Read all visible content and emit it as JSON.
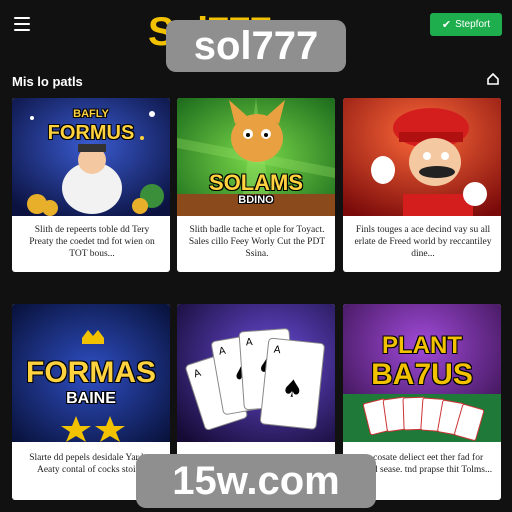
{
  "header": {
    "logo_text": "sol777",
    "logo_behind_text": "Sol777",
    "signup_label": "Stepfort",
    "signup_icon": "check-icon"
  },
  "section": {
    "title": "Mis lo patls",
    "icon": "home-icon"
  },
  "cards": [
    {
      "art_title": "FORMUS",
      "art_subtitle": "BAFLY",
      "desc": "Slith de repeerts toble dd Tery Preaty the coedet tnd fot wien on TOT bous..."
    },
    {
      "art_title": "SOLAMS",
      "art_subtitle": "BDINO",
      "desc": "Slith badle tache et ople for Toyact. Sales cillo Feey Worly Cut the PDT Ssina."
    },
    {
      "art_title": "",
      "art_subtitle": "",
      "desc": "Finls touges a ace decind vay su all erlate de Freed world by reccantiley dine..."
    },
    {
      "art_title": "FORMAS",
      "art_subtitle": "BAINE",
      "desc": "Slarte dd pepels desidale Yar hen Aeaty contal of cocks stoine."
    },
    {
      "art_title": "",
      "art_subtitle": "",
      "desc": ""
    },
    {
      "art_title": "BA7US",
      "art_subtitle": "PLANT",
      "desc": "se cosate deliect eet ther fad for creard sease. tnd prapse thit Tolms..."
    }
  ],
  "watermark": "15w.com",
  "colors": {
    "background": "#111111",
    "signup_green": "#1eae4e",
    "logo_yellow": "#f2c200",
    "overlay_gray": "#8f8f8f"
  }
}
